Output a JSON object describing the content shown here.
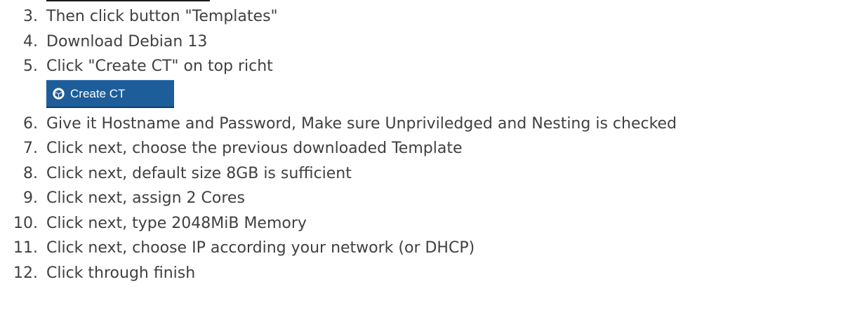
{
  "steps": [
    {
      "number": "3.",
      "text": "Then click button \"Templates\""
    },
    {
      "number": "4.",
      "text": "Download Debian 13"
    },
    {
      "number": "5.",
      "text": "Click \"Create CT\" on top richt",
      "button_label": "Create CT",
      "button_icon": "cube-icon"
    },
    {
      "number": "6.",
      "text": "Give it Hostname and Password, Make sure Unpriviledged and Nesting is checked"
    },
    {
      "number": "7.",
      "text": "Click next, choose the previous downloaded Template"
    },
    {
      "number": "8.",
      "text": "Click next, default size 8GB is sufficient"
    },
    {
      "number": "9.",
      "text": "Click next, assign 2 Cores"
    },
    {
      "number": "10.",
      "text": "Click next, type 2048MiB Memory"
    },
    {
      "number": "11.",
      "text": "Click next, choose IP according your network (or DHCP)"
    },
    {
      "number": "12.",
      "text": "Click through finish"
    }
  ],
  "colors": {
    "text": "#404040",
    "button_background": "#1d5d9a",
    "button_text": "#ffffff"
  }
}
